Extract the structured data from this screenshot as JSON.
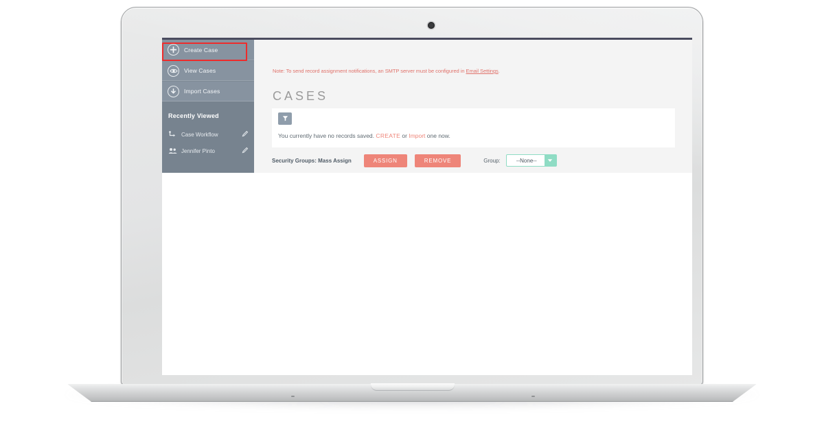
{
  "app": {
    "page_title": "CASES",
    "notice": {
      "prefix": "Note: To send record assignment notifications, an SMTP server must be configured in ",
      "link": "Email Settings",
      "suffix": "."
    }
  },
  "sidebar": {
    "nav_items": [
      {
        "label": "Create Case",
        "icon": "plus-circle-icon",
        "highlighted": true
      },
      {
        "label": "View Cases",
        "icon": "eye-circle-icon",
        "highlighted": false
      },
      {
        "label": "Import Cases",
        "icon": "download-circle-icon",
        "highlighted": false
      }
    ],
    "recently_viewed": {
      "header": "Recently Viewed",
      "items": [
        {
          "label": "Case Workflow",
          "icon": "workflow-icon",
          "action_icon": "pencil-icon"
        },
        {
          "label": "Jennifer Pinto",
          "icon": "users-icon",
          "action_icon": "pencil-icon"
        }
      ]
    },
    "collapse_icon": "collapse-left-icon"
  },
  "records_panel": {
    "filter_icon": "funnel-icon",
    "empty_message": {
      "prefix": "You currently have no records saved. ",
      "create_link": "CREATE",
      "middle": " or ",
      "import_link": "Import",
      "suffix": " one now."
    }
  },
  "mass_assign": {
    "label": "Security Groups: Mass Assign",
    "assign_button": "ASSIGN",
    "remove_button": "REMOVE",
    "group_label": "Group:",
    "group_value": "--None--",
    "dropdown_icon": "chevron-down-icon"
  },
  "colors": {
    "sidebar_bg": "#77838f",
    "nav_item_bg": "#8793a0",
    "accent_coral": "#ee8579",
    "notice_red": "#e0716a",
    "select_teal": "#8fdcc4",
    "highlight_red": "#ee2b2b",
    "topbar": "#4a4b5e"
  }
}
